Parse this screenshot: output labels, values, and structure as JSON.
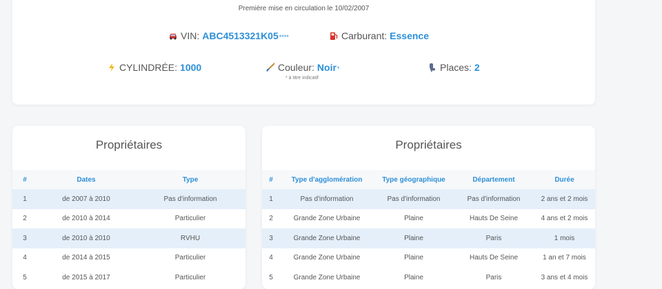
{
  "vehicle": {
    "first_registration": "Première mise en circulation le 10/02/2007",
    "vin_label": "VIN:",
    "vin_value": "ABC4513321K05",
    "vin_mask": "****",
    "fuel_label": "Carburant:",
    "fuel_value": "Essence",
    "displacement_label": "CYLINDRÉE:",
    "displacement_value": "1000",
    "color_label": "Couleur:",
    "color_value": "Noir",
    "color_star": "*",
    "color_note": "* à titre indicatif",
    "seats_label": "Places:",
    "seats_value": "2"
  },
  "owners_table": {
    "title": "Propriétaires",
    "headers": [
      "#",
      "Dates",
      "Type"
    ],
    "rows": [
      [
        "1",
        "de 2007 à 2010",
        "Pas d'information"
      ],
      [
        "2",
        "de 2010 à 2014",
        "Particulier"
      ],
      [
        "3",
        "de 2010 à 2010",
        "RVHU"
      ],
      [
        "4",
        "de 2014 à 2015",
        "Particulier"
      ],
      [
        "5",
        "de 2015 à 2017",
        "Particulier"
      ]
    ]
  },
  "details_table": {
    "title": "Propriétaires",
    "headers": [
      "#",
      "Type d'agglomération",
      "Type géographique",
      "Département",
      "Durée"
    ],
    "rows": [
      [
        "1",
        "Pas d'information",
        "Pas d'information",
        "Pas d'information",
        "2 ans et 2 mois"
      ],
      [
        "2",
        "Grande Zone Urbaine",
        "Plaine",
        "Hauts De Seine",
        "4 ans et 2 mois"
      ],
      [
        "3",
        "Grande Zone Urbaine",
        "Plaine",
        "Paris",
        "1 mois"
      ],
      [
        "4",
        "Grande Zone Urbaine",
        "Plaine",
        "Hauts De Seine",
        "1 an et 7 mois"
      ],
      [
        "5",
        "Grande Zone Urbaine",
        "Plaine",
        "Paris",
        "3 ans et 4 mois"
      ]
    ]
  },
  "icons": {
    "vin": "car-icon",
    "fuel": "fuel-pump-icon",
    "displacement": "lightning-icon",
    "color": "paintbrush-icon",
    "seats": "seat-icon"
  },
  "colors": {
    "accent": "#2d8fd8",
    "highlight_row": "#e4effa",
    "header_row": "#f7f8fa",
    "background": "#f5f6f8"
  }
}
